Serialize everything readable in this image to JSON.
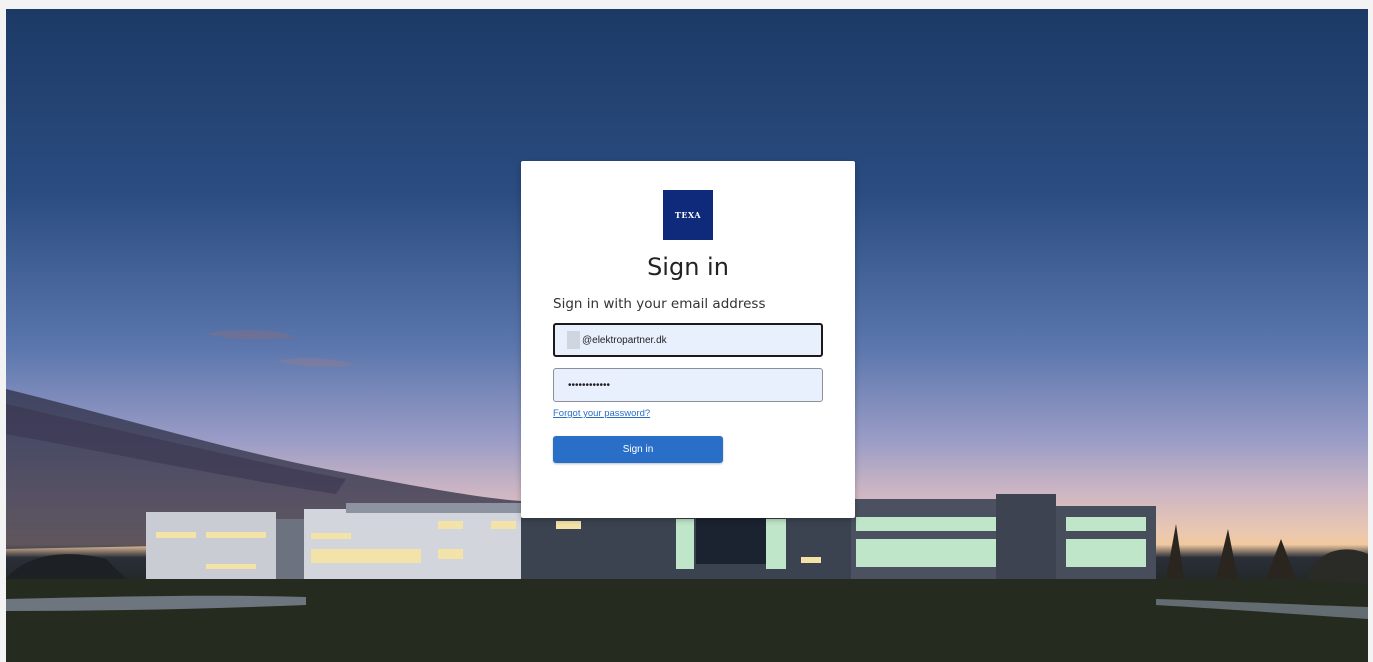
{
  "brand": {
    "logo_text": "TEXA",
    "logo_color": "#0f2a7a"
  },
  "form": {
    "title": "Sign in",
    "subtitle": "Sign in with your email address",
    "email_value": "@elektropartner.dk",
    "password_value": "••••••••••••",
    "forgot_link": "Forgot your password?",
    "submit_label": "Sign in",
    "accent_color": "#2a6fc7"
  }
}
